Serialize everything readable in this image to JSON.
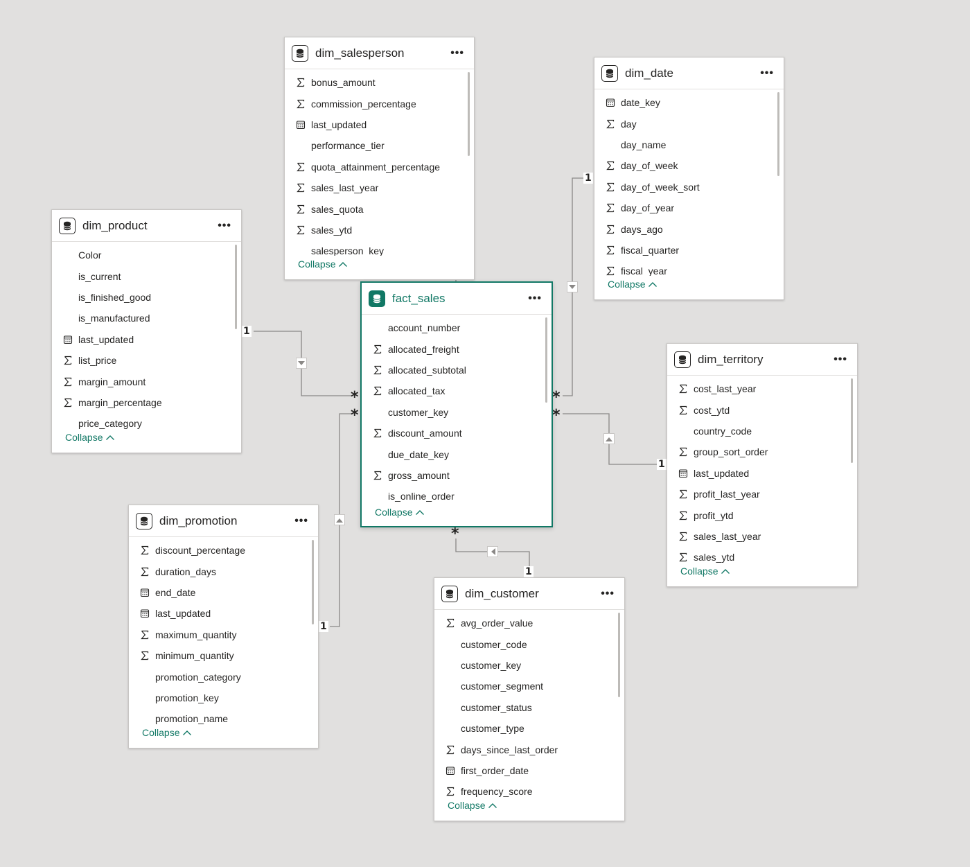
{
  "colors": {
    "canvas": "#e1e0df",
    "accent": "#117865",
    "line": "#8a8886",
    "text": "#252423"
  },
  "icons": {
    "table": "database-icon",
    "sum": "sigma-icon",
    "date": "calendar-icon",
    "more": "more-options-icon",
    "collapse": "chevron-up-icon"
  },
  "more_label": "•••",
  "many_marker": "*",
  "one_marker": "1",
  "tables": {
    "dim_salesperson": {
      "title": "dim_salesperson",
      "collapse": "Collapse",
      "fields": [
        {
          "name": "bonus_amount",
          "icon": "sum"
        },
        {
          "name": "commission_percentage",
          "icon": "sum"
        },
        {
          "name": "last_updated",
          "icon": "date"
        },
        {
          "name": "performance_tier",
          "icon": "none"
        },
        {
          "name": "quota_attainment_percentage",
          "icon": "sum"
        },
        {
          "name": "sales_last_year",
          "icon": "sum"
        },
        {
          "name": "sales_quota",
          "icon": "sum"
        },
        {
          "name": "sales_ytd",
          "icon": "sum"
        },
        {
          "name": "salesperson_key",
          "icon": "none"
        }
      ]
    },
    "dim_date": {
      "title": "dim_date",
      "collapse": "Collapse",
      "fields": [
        {
          "name": "date_key",
          "icon": "date"
        },
        {
          "name": "day",
          "icon": "sum"
        },
        {
          "name": "day_name",
          "icon": "none"
        },
        {
          "name": "day_of_week",
          "icon": "sum"
        },
        {
          "name": "day_of_week_sort",
          "icon": "sum"
        },
        {
          "name": "day_of_year",
          "icon": "sum"
        },
        {
          "name": "days_ago",
          "icon": "sum"
        },
        {
          "name": "fiscal_quarter",
          "icon": "sum"
        },
        {
          "name": "fiscal_year",
          "icon": "sum"
        }
      ]
    },
    "dim_product": {
      "title": "dim_product",
      "collapse": "Collapse",
      "fields": [
        {
          "name": "Color",
          "icon": "none"
        },
        {
          "name": "is_current",
          "icon": "none"
        },
        {
          "name": "is_finished_good",
          "icon": "none"
        },
        {
          "name": "is_manufactured",
          "icon": "none"
        },
        {
          "name": "last_updated",
          "icon": "date"
        },
        {
          "name": "list_price",
          "icon": "sum"
        },
        {
          "name": "margin_amount",
          "icon": "sum"
        },
        {
          "name": "margin_percentage",
          "icon": "sum"
        },
        {
          "name": "price_category",
          "icon": "none"
        }
      ]
    },
    "fact_sales": {
      "title": "fact_sales",
      "collapse": "Collapse",
      "fields": [
        {
          "name": "account_number",
          "icon": "none"
        },
        {
          "name": "allocated_freight",
          "icon": "sum"
        },
        {
          "name": "allocated_subtotal",
          "icon": "sum"
        },
        {
          "name": "allocated_tax",
          "icon": "sum"
        },
        {
          "name": "customer_key",
          "icon": "none"
        },
        {
          "name": "discount_amount",
          "icon": "sum"
        },
        {
          "name": "due_date_key",
          "icon": "none"
        },
        {
          "name": "gross_amount",
          "icon": "sum"
        },
        {
          "name": "is_online_order",
          "icon": "none"
        }
      ]
    },
    "dim_territory": {
      "title": "dim_territory",
      "collapse": "Collapse",
      "fields": [
        {
          "name": "cost_last_year",
          "icon": "sum"
        },
        {
          "name": "cost_ytd",
          "icon": "sum"
        },
        {
          "name": "country_code",
          "icon": "none"
        },
        {
          "name": "group_sort_order",
          "icon": "sum"
        },
        {
          "name": "last_updated",
          "icon": "date"
        },
        {
          "name": "profit_last_year",
          "icon": "sum"
        },
        {
          "name": "profit_ytd",
          "icon": "sum"
        },
        {
          "name": "sales_last_year",
          "icon": "sum"
        },
        {
          "name": "sales_ytd",
          "icon": "sum"
        }
      ]
    },
    "dim_promotion": {
      "title": "dim_promotion",
      "collapse": "Collapse",
      "fields": [
        {
          "name": "discount_percentage",
          "icon": "sum"
        },
        {
          "name": "duration_days",
          "icon": "sum"
        },
        {
          "name": "end_date",
          "icon": "date"
        },
        {
          "name": "last_updated",
          "icon": "date"
        },
        {
          "name": "maximum_quantity",
          "icon": "sum"
        },
        {
          "name": "minimum_quantity",
          "icon": "sum"
        },
        {
          "name": "promotion_category",
          "icon": "none"
        },
        {
          "name": "promotion_key",
          "icon": "none"
        },
        {
          "name": "promotion_name",
          "icon": "none"
        }
      ]
    },
    "dim_customer": {
      "title": "dim_customer",
      "collapse": "Collapse",
      "fields": [
        {
          "name": "avg_order_value",
          "icon": "sum"
        },
        {
          "name": "customer_code",
          "icon": "none"
        },
        {
          "name": "customer_key",
          "icon": "none"
        },
        {
          "name": "customer_segment",
          "icon": "none"
        },
        {
          "name": "customer_status",
          "icon": "none"
        },
        {
          "name": "customer_type",
          "icon": "none"
        },
        {
          "name": "days_since_last_order",
          "icon": "sum"
        },
        {
          "name": "first_order_date",
          "icon": "date"
        },
        {
          "name": "frequency_score",
          "icon": "sum"
        }
      ]
    }
  },
  "relationships": [
    {
      "from": "dim_product",
      "to": "fact_sales",
      "from_card": "1",
      "to_card": "*",
      "direction": "down"
    },
    {
      "from": "dim_promotion",
      "to": "fact_sales",
      "from_card": "1",
      "to_card": "*",
      "direction": "up"
    },
    {
      "from": "dim_date",
      "to": "fact_sales",
      "from_card": "1",
      "to_card": "*",
      "direction": "down"
    },
    {
      "from": "dim_territory",
      "to": "fact_sales",
      "from_card": "1",
      "to_card": "*",
      "direction": "up"
    },
    {
      "from": "dim_customer",
      "to": "fact_sales",
      "from_card": "1",
      "to_card": "*",
      "direction": "left"
    },
    {
      "from": "dim_salesperson",
      "to": "fact_sales",
      "from_card": "1",
      "to_card": "*",
      "direction": "down"
    }
  ]
}
